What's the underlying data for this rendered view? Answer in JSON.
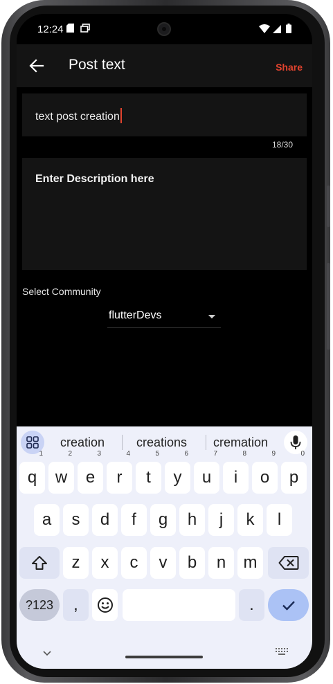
{
  "status_bar": {
    "time": "12:24"
  },
  "app_bar": {
    "title": "Post text",
    "share_label": "Share"
  },
  "form": {
    "title_value": "text post creation",
    "counter": "18/30",
    "description_placeholder": "Enter Description here",
    "community_label": "Select Community",
    "community_selected": "flutterDevs"
  },
  "keyboard": {
    "suggestions": [
      "creation",
      "creations",
      "cremation"
    ],
    "row1": [
      {
        "k": "q",
        "h": "1"
      },
      {
        "k": "w",
        "h": "2"
      },
      {
        "k": "e",
        "h": "3"
      },
      {
        "k": "r",
        "h": "4"
      },
      {
        "k": "t",
        "h": "5"
      },
      {
        "k": "y",
        "h": "6"
      },
      {
        "k": "u",
        "h": "7"
      },
      {
        "k": "i",
        "h": "8"
      },
      {
        "k": "o",
        "h": "9"
      },
      {
        "k": "p",
        "h": "0"
      }
    ],
    "row2": [
      "a",
      "s",
      "d",
      "f",
      "g",
      "h",
      "j",
      "k",
      "l"
    ],
    "row3": [
      "z",
      "x",
      "c",
      "v",
      "b",
      "n",
      "m"
    ],
    "symbols_label": "?123",
    "comma": ",",
    "period": "."
  },
  "colors": {
    "accent": "#e2432e",
    "keyboard_bg": "#eef0fa",
    "done_key": "#abc2f5"
  }
}
